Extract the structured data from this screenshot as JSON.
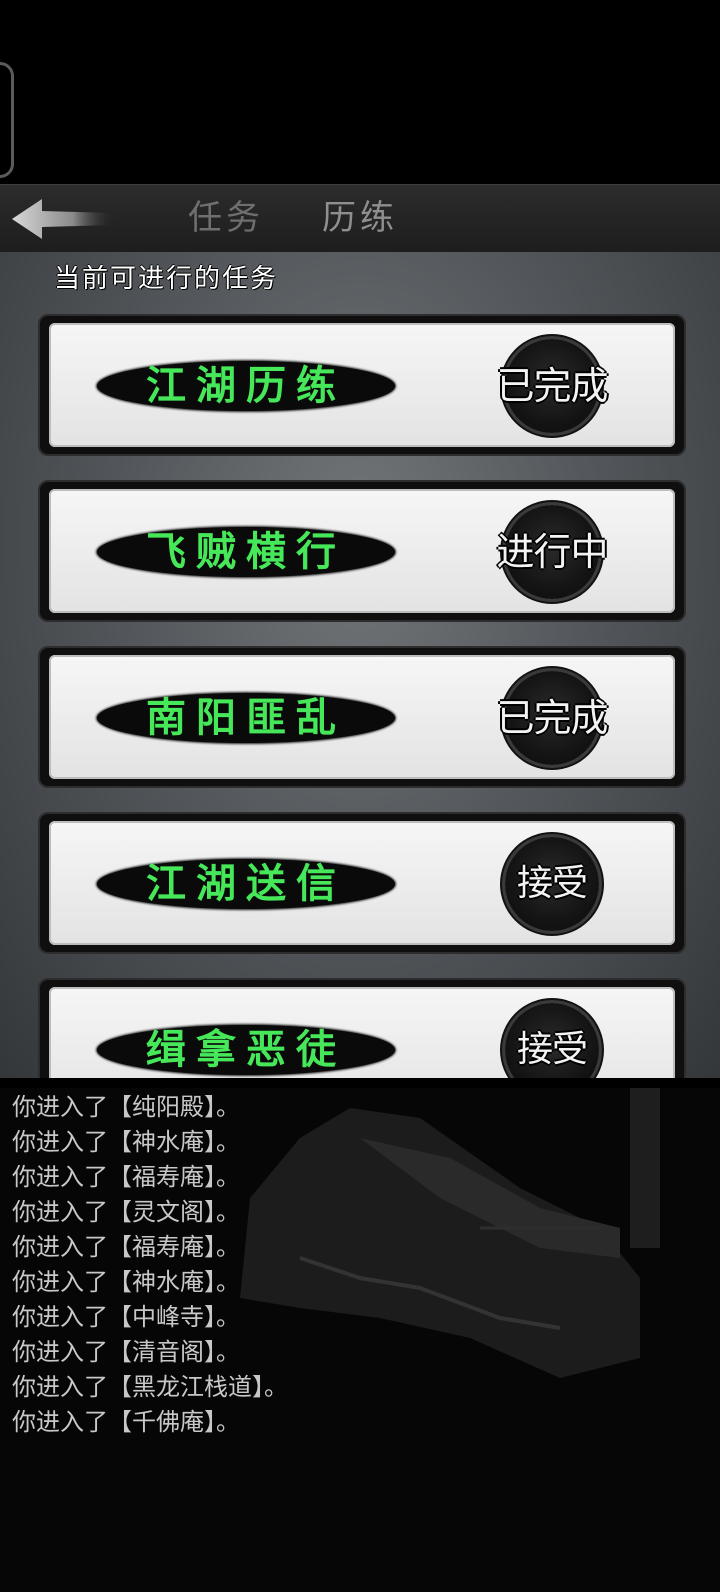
{
  "tabs": {
    "tasks": "任务",
    "training": "历练"
  },
  "section_title": "当前可进行的任务",
  "tasks": [
    {
      "name": "江湖历练",
      "status": "已完成"
    },
    {
      "name": "飞贼横行",
      "status": "进行中"
    },
    {
      "name": "南阳匪乱",
      "status": "已完成"
    },
    {
      "name": "江湖送信",
      "status": "接受"
    },
    {
      "name": "缉拿恶徒",
      "status": "接受"
    }
  ],
  "log": [
    "你进入了【纯阳殿】。",
    "你进入了【神水庵】。",
    "你进入了【福寿庵】。",
    "你进入了【灵文阁】。",
    "你进入了【福寿庵】。",
    "你进入了【神水庵】。",
    "你进入了【中峰寺】。",
    "你进入了【清音阁】。",
    "你进入了【黑龙江栈道】。",
    "你进入了【千佛庵】。"
  ],
  "icons": {
    "back": "back-arrow-icon"
  },
  "colors": {
    "task_name": "#46e85a",
    "panel": "#55595d"
  }
}
